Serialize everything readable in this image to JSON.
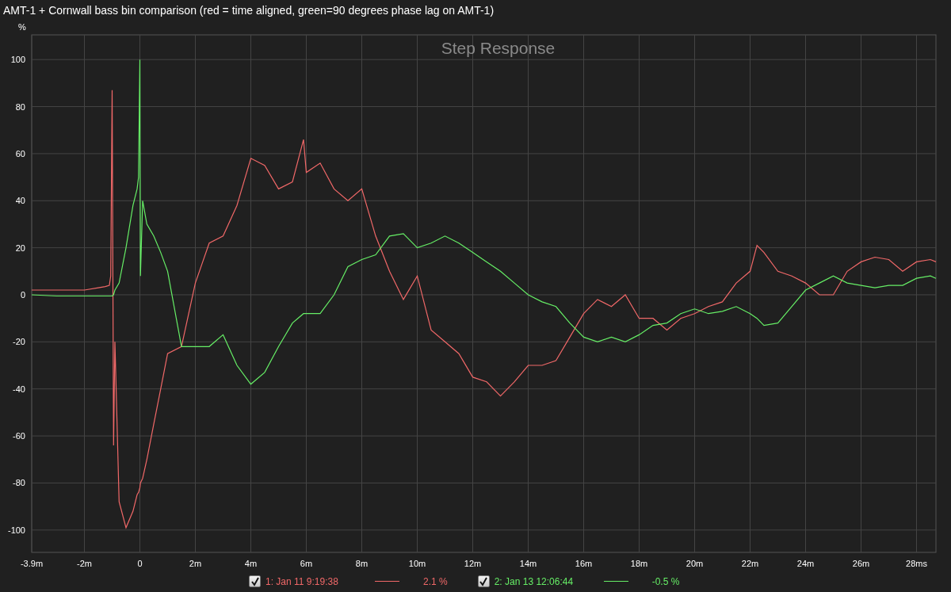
{
  "title": "AMT-1 + Cornwall bass bin comparison (red = time aligned, green=90 degrees phase lag on AMT-1)",
  "chart": {
    "chart_data": {
      "type": "line",
      "title": "Step Response",
      "ylabel": "%",
      "x": [
        -3.9,
        -3,
        -2,
        -1.5,
        -1.25,
        -1.1,
        -1.05,
        -1,
        -0.95,
        -0.9,
        -0.75,
        -0.5,
        -0.25,
        -0.1,
        -0.05,
        0,
        0.02,
        0.1,
        0.25,
        0.5,
        0.75,
        1,
        1.5,
        2,
        2.5,
        3,
        3.5,
        4,
        4.5,
        5,
        5.5,
        5.9,
        6,
        6.5,
        7,
        7.5,
        8,
        8.5,
        9,
        9.5,
        10,
        10.5,
        11,
        11.5,
        12,
        12.5,
        13,
        13.5,
        14,
        14.5,
        15,
        15.5,
        16,
        16.5,
        17,
        17.5,
        18,
        18.5,
        19,
        19.5,
        20,
        20.5,
        21,
        21.5,
        22,
        22.25,
        22.5,
        23,
        23.5,
        24,
        24.5,
        25,
        25.5,
        26,
        26.5,
        27,
        27.5,
        28,
        28.5,
        28.7
      ],
      "series": [
        {
          "name": "1: Jan 11 9:19:38",
          "color": "#f06868",
          "values": [
            2,
            2,
            2,
            3,
            3.5,
            4,
            8,
            87,
            -64,
            -20,
            -88,
            -99,
            -92,
            -85,
            -84,
            -82,
            -80,
            -78,
            -70,
            -55,
            -40,
            -25,
            -22,
            5,
            22,
            25,
            38,
            58,
            55,
            45,
            48,
            66,
            52,
            56,
            45,
            40,
            45,
            25,
            10,
            -2,
            8,
            -15,
            -20,
            -25,
            -35,
            -37,
            -43,
            -37,
            -30,
            -30,
            -28,
            -18,
            -8,
            -2,
            -5,
            0,
            -10,
            -10,
            -15,
            -10,
            -8,
            -5,
            -3,
            5,
            10,
            21,
            18,
            10,
            8,
            5,
            0,
            0,
            10,
            14,
            16,
            15,
            10,
            14,
            15,
            14
          ]
        },
        {
          "name": "2: Jan 13 12:06:44",
          "color": "#66ee66",
          "values": [
            0,
            -0.5,
            -0.5,
            -0.5,
            -0.5,
            -0.5,
            -0.5,
            -0.5,
            0,
            2,
            5,
            20,
            38,
            45,
            50,
            100,
            8,
            40,
            30,
            25,
            18,
            10,
            -22,
            -22,
            -22,
            -17,
            -30,
            -38,
            -33,
            -22,
            -12,
            -8,
            -8,
            -8,
            0,
            12,
            15,
            17,
            25,
            26,
            20,
            22,
            25,
            22,
            18,
            14,
            10,
            5,
            0,
            -3,
            -5,
            -12,
            -18,
            -20,
            -18,
            -20,
            -17,
            -13,
            -12,
            -8,
            -6,
            -8,
            -7,
            -5,
            -8,
            -10,
            -13,
            -12,
            -5,
            2,
            5,
            8,
            5,
            4,
            3,
            4,
            4,
            7,
            8,
            7
          ]
        }
      ],
      "xlim": [
        -3.9,
        28.7
      ],
      "ylim": [
        -109.5,
        110.5
      ],
      "xticks": [
        {
          "value": -3.9,
          "label": "-3.9m"
        },
        {
          "value": -2,
          "label": "-2m"
        },
        {
          "value": 0,
          "label": "0"
        },
        {
          "value": 2,
          "label": "2m"
        },
        {
          "value": 4,
          "label": "4m"
        },
        {
          "value": 6,
          "label": "6m"
        },
        {
          "value": 8,
          "label": "8m"
        },
        {
          "value": 10,
          "label": "10m"
        },
        {
          "value": 12,
          "label": "12m"
        },
        {
          "value": 14,
          "label": "14m"
        },
        {
          "value": 16,
          "label": "16m"
        },
        {
          "value": 18,
          "label": "18m"
        },
        {
          "value": 20,
          "label": "20m"
        },
        {
          "value": 22,
          "label": "22m"
        },
        {
          "value": 24,
          "label": "24m"
        },
        {
          "value": 26,
          "label": "26m"
        },
        {
          "value": 28,
          "label": "28ms"
        }
      ],
      "yticks": [
        -100,
        -80,
        -60,
        -40,
        -20,
        0,
        20,
        40,
        60,
        80,
        100
      ],
      "grid": true
    }
  },
  "legend": [
    {
      "checked": true,
      "reading": "2.1 %"
    },
    {
      "checked": true,
      "reading": "-0.5 %"
    }
  ]
}
